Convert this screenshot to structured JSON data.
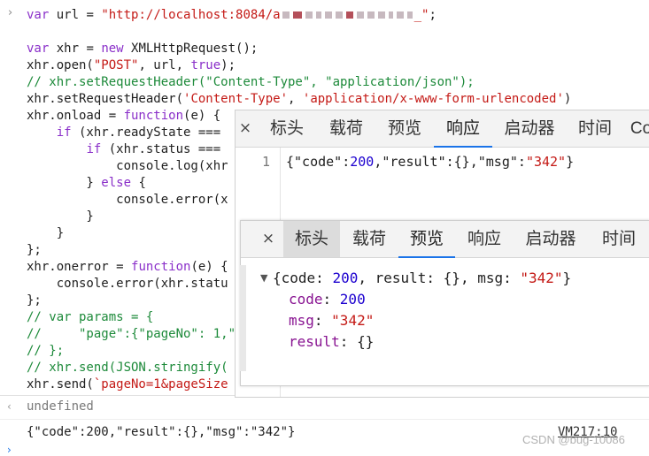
{
  "console": {
    "code_lines": [
      [
        {
          "t": "var",
          "c": "kw"
        },
        {
          "t": " url = "
        },
        {
          "t": "\"http://localhost:8084/a",
          "c": "str"
        },
        {
          "r": [
            [
              8,
              0
            ],
            [
              10,
              1
            ],
            [
              8,
              0
            ],
            [
              6,
              0
            ],
            [
              8,
              0
            ],
            [
              8,
              0
            ],
            [
              8,
              1
            ],
            [
              8,
              0
            ],
            [
              8,
              0
            ],
            [
              8,
              0
            ],
            [
              5,
              0
            ],
            [
              8,
              0
            ],
            [
              6,
              0
            ]
          ]
        },
        {
          "t": "_\"",
          "c": "str"
        },
        {
          "t": ";"
        }
      ],
      [],
      [
        {
          "t": "var",
          "c": "kw"
        },
        {
          "t": " xhr = "
        },
        {
          "t": "new",
          "c": "kw"
        },
        {
          "t": " XMLHttpRequest();"
        }
      ],
      [
        {
          "t": "xhr.open("
        },
        {
          "t": "\"POST\"",
          "c": "str"
        },
        {
          "t": ", url, "
        },
        {
          "t": "true",
          "c": "kw"
        },
        {
          "t": ");"
        }
      ],
      [
        {
          "t": "// xhr.setRequestHeader(\"Content-Type\", \"application/json\");",
          "c": "cmt"
        }
      ],
      [
        {
          "t": "xhr.setRequestHeader("
        },
        {
          "t": "'Content-Type'",
          "c": "str"
        },
        {
          "t": ", "
        },
        {
          "t": "'application/x-www-form-urlencoded'",
          "c": "str"
        },
        {
          "t": ")"
        }
      ],
      [
        {
          "t": "xhr.onload = "
        },
        {
          "t": "function",
          "c": "kw"
        },
        {
          "t": "(e) {"
        }
      ],
      [
        {
          "t": "    "
        },
        {
          "t": "if",
          "c": "kw"
        },
        {
          "t": " (xhr.readyState ==="
        }
      ],
      [
        {
          "t": "        "
        },
        {
          "t": "if",
          "c": "kw"
        },
        {
          "t": " (xhr.status ==="
        }
      ],
      [
        {
          "t": "            console.log(xhr"
        }
      ],
      [
        {
          "t": "        } "
        },
        {
          "t": "else",
          "c": "kw"
        },
        {
          "t": " {"
        }
      ],
      [
        {
          "t": "            console.error(x"
        }
      ],
      [
        {
          "t": "        }"
        }
      ],
      [
        {
          "t": "    }"
        }
      ],
      [
        {
          "t": "};"
        }
      ],
      [
        {
          "t": "xhr.onerror = "
        },
        {
          "t": "function",
          "c": "kw"
        },
        {
          "t": "(e) {"
        }
      ],
      [
        {
          "t": "    console.error(xhr.statu"
        }
      ],
      [
        {
          "t": "};"
        }
      ],
      [
        {
          "t": "// var params = {",
          "c": "cmt"
        }
      ],
      [
        {
          "t": "//     \"page\":{\"pageNo\": 1,\"",
          "c": "cmt"
        }
      ],
      [
        {
          "t": "// };",
          "c": "cmt"
        }
      ],
      [
        {
          "t": "// xhr.send(JSON.stringify(",
          "c": "cmt"
        }
      ],
      [
        {
          "t": "xhr.send("
        },
        {
          "t": "`pageNo=1&pageSize",
          "c": "str"
        }
      ]
    ],
    "prompt_chevron": "›",
    "return_arrow": "‹",
    "undefined_text": "undefined",
    "output_text": "{\"code\":200,\"result\":{},\"msg\":\"342\"}",
    "vm_link": "VM217:10",
    "bottom_prompt": "›"
  },
  "panel1": {
    "close": "×",
    "tabs": [
      {
        "label": "标头",
        "active": false
      },
      {
        "label": "载荷",
        "active": false
      },
      {
        "label": "预览",
        "active": false
      },
      {
        "label": "响应",
        "active": true
      },
      {
        "label": "启动器",
        "active": false
      },
      {
        "label": "时间",
        "active": false
      },
      {
        "label": "Co",
        "active": false
      }
    ],
    "line_number": "1",
    "response_segments": [
      {
        "t": "{\"code\":",
        "c": ""
      },
      {
        "t": "200",
        "c": "num"
      },
      {
        "t": ",\"result\":{},\"msg\":",
        "c": ""
      },
      {
        "t": "\"342\"",
        "c": "str"
      },
      {
        "t": "}",
        "c": ""
      }
    ]
  },
  "panel2": {
    "close": "×",
    "tabs": [
      {
        "label": "标头",
        "active": false,
        "hl": true
      },
      {
        "label": "载荷",
        "active": false,
        "hl": false
      },
      {
        "label": "预览",
        "active": true,
        "hl": false
      },
      {
        "label": "响应",
        "active": false,
        "hl": false
      },
      {
        "label": "启动器",
        "active": false,
        "hl": false
      },
      {
        "label": "时间",
        "active": false,
        "hl": false
      }
    ],
    "tree": {
      "toggle": "▼",
      "summary": [
        {
          "t": "{code: ",
          "c": ""
        },
        {
          "t": "200",
          "c": "num"
        },
        {
          "t": ", result: {}, msg: ",
          "c": ""
        },
        {
          "t": "\"342\"",
          "c": "str"
        },
        {
          "t": "}",
          "c": ""
        }
      ],
      "props": [
        {
          "key": "code",
          "sep": ": ",
          "value": "200",
          "vc": "num"
        },
        {
          "key": "msg",
          "sep": ": ",
          "value": "\"342\"",
          "vc": "str"
        },
        {
          "key": "result",
          "sep": ": ",
          "value": "{}",
          "vc": ""
        }
      ]
    }
  },
  "watermark": "CSDN @bug-10086"
}
